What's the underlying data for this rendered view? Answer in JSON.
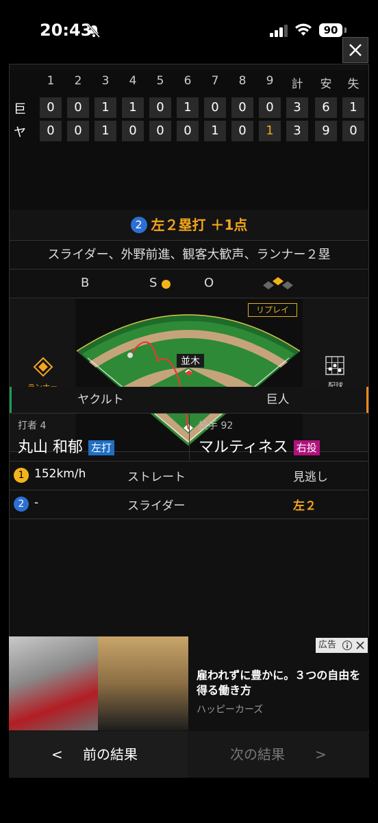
{
  "status_bar": {
    "time": "20:43",
    "battery": "90"
  },
  "scoreboard": {
    "headers": [
      "1",
      "2",
      "3",
      "4",
      "5",
      "6",
      "7",
      "8",
      "9",
      "計",
      "安",
      "失"
    ],
    "rows": [
      {
        "team": "巨",
        "cells": [
          "0",
          "0",
          "1",
          "1",
          "0",
          "1",
          "0",
          "0",
          "0",
          "3",
          "6",
          "1"
        ]
      },
      {
        "team": "ヤ",
        "cells": [
          "0",
          "0",
          "1",
          "0",
          "0",
          "0",
          "1",
          "0",
          "1",
          "3",
          "9",
          "0"
        ]
      }
    ],
    "highlight_color": "#f3a51d"
  },
  "play": {
    "number": "2",
    "result": "左２塁打 ＋1点"
  },
  "description": "スライダー、外野前進、観客大歓声、ランナー２塁",
  "count": {
    "b": "B",
    "s": "S",
    "o": "O"
  },
  "field": {
    "replay_label": "リプレイ",
    "fielder_label": "並木",
    "runner_label": "ランナー",
    "pitch_label": "配球"
  },
  "teams": {
    "home": "ヤクルト",
    "away": "巨人"
  },
  "batter": {
    "number": "打者 4",
    "name": "丸山 和郁",
    "hand": "左打"
  },
  "pitcher": {
    "number": "投手 92",
    "name": "マルティネス",
    "hand": "右投"
  },
  "pitches": [
    {
      "n": "1",
      "speed": "152km/h",
      "type": "ストレート",
      "result": "見逃し"
    },
    {
      "n": "2",
      "speed": "-",
      "type": "スライダー",
      "result": "左２"
    }
  ],
  "ad": {
    "badge": "広告",
    "title": "雇われずに豊かに。３つの自由を得る働き方",
    "source": "ハッピーカーズ"
  },
  "nav": {
    "prev": "前の結果",
    "next": "次の結果"
  }
}
